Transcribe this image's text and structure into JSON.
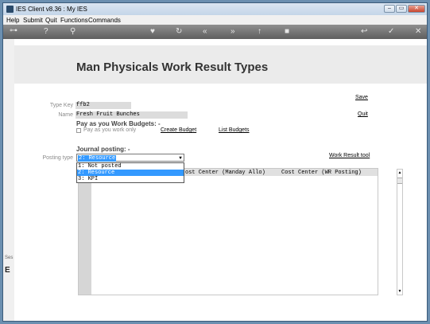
{
  "window": {
    "title": "IES Client v8.36 : My IES",
    "controls": {
      "minimize": "–",
      "maximize": "▭",
      "close": "✕"
    }
  },
  "menu": [
    "Help",
    "Submit",
    "Quit",
    "Functions",
    "Commands"
  ],
  "toolbar_icons": [
    "key-icon",
    "help-icon",
    "search-icon",
    "heart-icon",
    "refresh-icon",
    "rewind-icon",
    "forward-icon",
    "upload-icon",
    "stop-icon",
    "back-icon",
    "check-icon",
    "close-icon"
  ],
  "page": {
    "title": "Man Physicals Work Result Types"
  },
  "form": {
    "type_key_label": "Type Key",
    "type_key_value": "ffb2",
    "name_label": "Name",
    "name_value": "Fresh Fruit Bunches",
    "save_link": "Save",
    "quit_link": "Quit",
    "budgets_heading": "Pay as you Work Budgets: -",
    "pay_as_you_work_only": "Pay as you work only",
    "create_budget_link": "Create Budget",
    "list_budgets_link": "List Budgets",
    "journal_heading": "Journal posting: -",
    "posting_type_label": "Posting type",
    "posting_type_value": "2: Resource",
    "work_result_tool_link": "Work Result tool",
    "posting_options": [
      "1: Not posted",
      "2: Resource",
      "3: KPI"
    ]
  },
  "grid": {
    "columns": [
      "ost Center (Manday Allo)",
      "Cost Center (WR Posting)"
    ]
  },
  "side": {
    "top": "Ses",
    "bottom": "E"
  },
  "colors": {
    "selection": "#3399ff",
    "toolbar": "#6e6e6e",
    "desktop": "#6b8fb0"
  }
}
